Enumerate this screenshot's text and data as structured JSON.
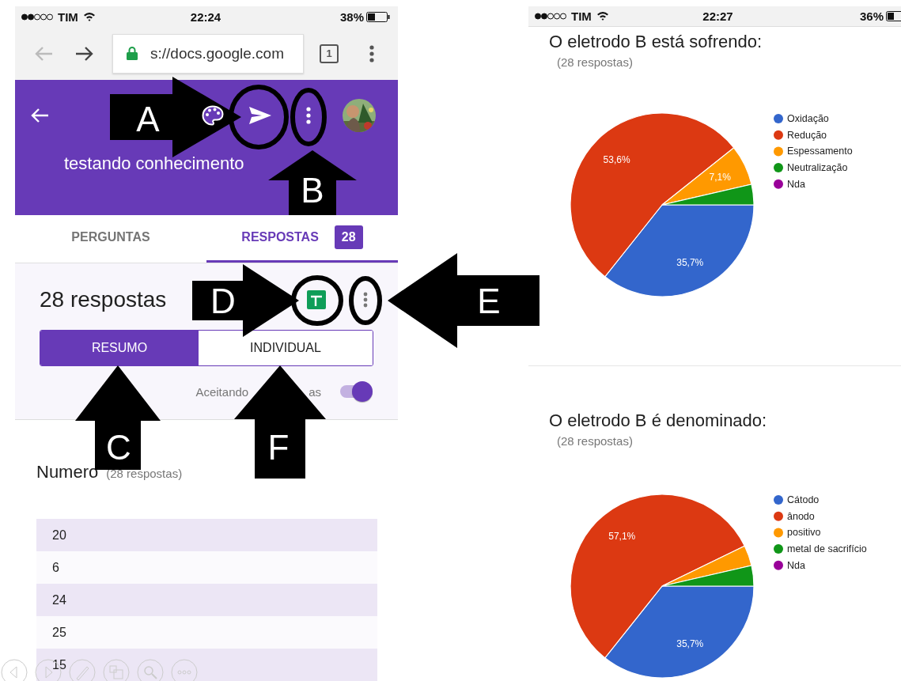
{
  "left_phone": {
    "status_bar": {
      "carrier": "TIM",
      "time": "22:24",
      "battery": "38%"
    },
    "browser": {
      "url": "s://docs.google.com",
      "tab_count": "1"
    },
    "form_title": "testando conhecimento",
    "tabs": [
      {
        "label": "PERGUNTAS",
        "selected": false
      },
      {
        "label": "RESPOSTAS",
        "selected": true,
        "badge": "28"
      }
    ],
    "summary": {
      "title": "28 respostas",
      "views": [
        {
          "label": "RESUMO",
          "selected": true
        },
        {
          "label": "INDIVIDUAL",
          "selected": false
        }
      ],
      "accepting": {
        "label_parts": [
          "Aceitando",
          "as"
        ],
        "on": true
      }
    },
    "question": {
      "title": "Numero",
      "count": "(28 respostas)",
      "answers": [
        "20",
        "6",
        "24",
        "25",
        "15"
      ]
    }
  },
  "right_phone": {
    "status_bar": {
      "carrier": "TIM",
      "time": "22:27",
      "battery": "36%"
    },
    "questions": [
      {
        "title": "O eletrodo B está sofrendo:",
        "count": "(28 respostas)",
        "chart_data": {
          "type": "pie",
          "categories": [
            "Oxidação",
            "Redução",
            "Espessamento",
            "Neutralização",
            "Nda"
          ],
          "values": [
            35.7,
            53.6,
            7.1,
            3.6,
            0
          ],
          "colors": [
            "#3366cc",
            "#dc3912",
            "#ff9900",
            "#109618",
            "#990099"
          ],
          "value_labels": [
            "35,7%",
            "53,6%",
            "7,1%",
            null,
            null
          ],
          "legend": "right"
        }
      },
      {
        "title": "O eletrodo B é denominado:",
        "count": "(28 respostas)",
        "chart_data": {
          "type": "pie",
          "categories": [
            "Cátodo",
            "ânodo",
            "positivo",
            "metal de sacrifício",
            "Nda"
          ],
          "values": [
            35.7,
            57.1,
            3.6,
            3.6,
            0
          ],
          "colors": [
            "#3366cc",
            "#dc3912",
            "#ff9900",
            "#109618",
            "#990099"
          ],
          "value_labels": [
            "35,7%",
            "57,1%",
            null,
            null,
            null
          ],
          "legend": "right"
        }
      }
    ]
  },
  "annotations": [
    {
      "label": "A",
      "kind": "arrow-right"
    },
    {
      "label": "B",
      "kind": "arrow-up"
    },
    {
      "label": "C",
      "kind": "arrow-up"
    },
    {
      "label": "D",
      "kind": "arrow-right"
    },
    {
      "label": "E",
      "kind": "arrow-left"
    },
    {
      "label": "F",
      "kind": "arrow-up"
    }
  ]
}
